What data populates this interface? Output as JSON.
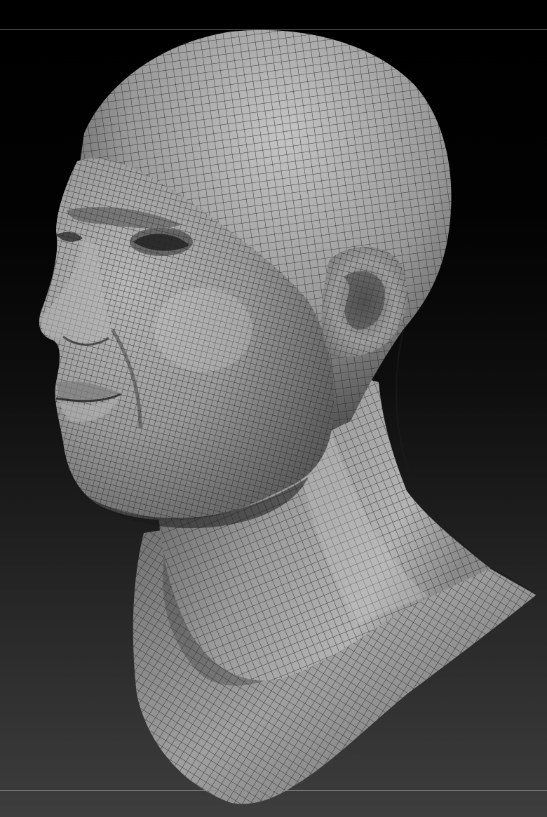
{
  "viewport": {
    "background_top": "#000000",
    "background_bottom": "#3e3e3e",
    "frame_line_color": "#7a7a7a"
  },
  "model": {
    "subject": "head-and-neck-bust",
    "display": "wireframe-quad-mesh",
    "surface_color": "#8c8c8c",
    "wire_color": "#2a2a2a"
  }
}
